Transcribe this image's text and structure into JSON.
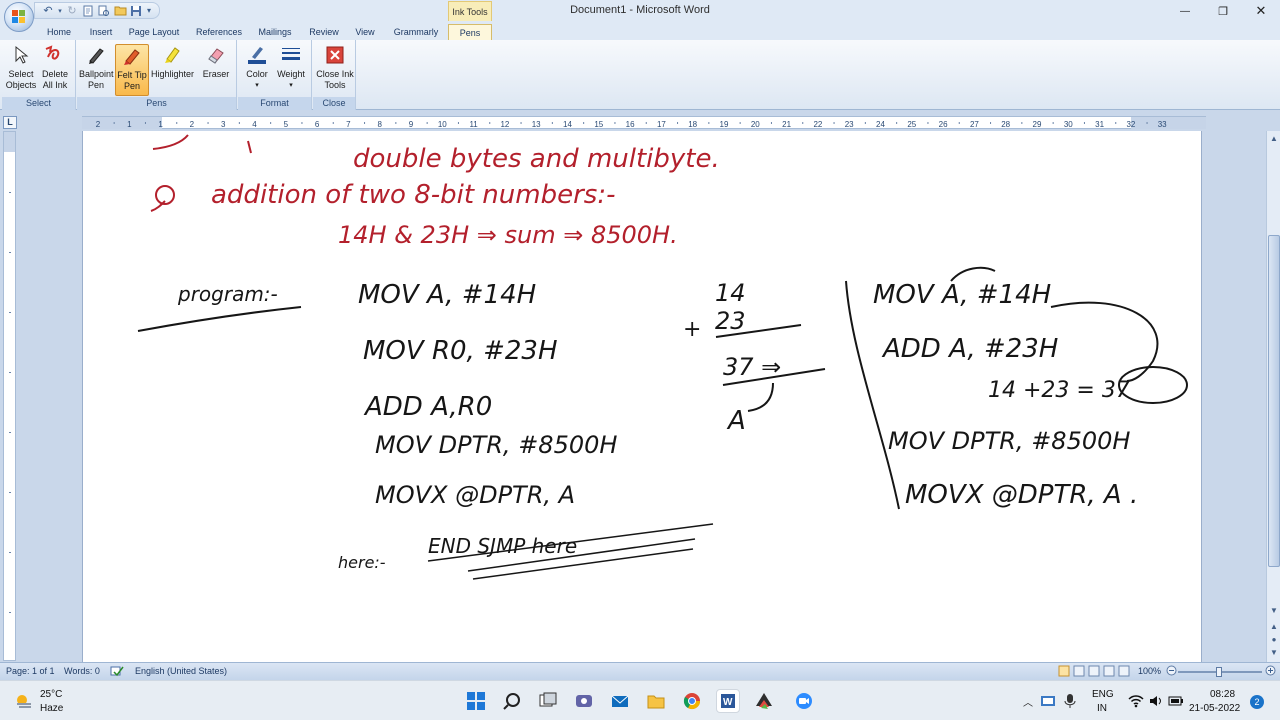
{
  "window": {
    "title": "Document1 - Microsoft Word",
    "context_tab_group": "Ink Tools",
    "controls": {
      "minimize": "—",
      "restore": "❐",
      "close": "✕"
    }
  },
  "tabs": [
    "Home",
    "Insert",
    "Page Layout",
    "References",
    "Mailings",
    "Review",
    "View",
    "Grammarly",
    "Pens"
  ],
  "ribbon": {
    "groups": [
      {
        "label": "Select",
        "buttons": [
          {
            "line1": "Select",
            "line2": "Objects"
          },
          {
            "line1": "Delete",
            "line2": "All Ink"
          }
        ]
      },
      {
        "label": "Pens",
        "buttons": [
          {
            "line1": "Ballpoint",
            "line2": "Pen"
          },
          {
            "line1": "Felt Tip",
            "line2": "Pen"
          },
          {
            "line1": "Highlighter",
            "line2": ""
          },
          {
            "line1": "Eraser",
            "line2": ""
          }
        ]
      },
      {
        "label": "Format",
        "buttons": [
          {
            "line1": "Color",
            "line2": ""
          },
          {
            "line1": "Weight",
            "line2": ""
          }
        ]
      },
      {
        "label": "Close",
        "buttons": [
          {
            "line1": "Close Ink",
            "line2": "Tools"
          }
        ]
      }
    ]
  },
  "ruler": {
    "corner": "L",
    "ticks": [
      "2",
      "1",
      "1",
      "2",
      "3",
      "4",
      "5",
      "6",
      "7",
      "8",
      "9",
      "10",
      "11",
      "12",
      "13",
      "14",
      "15",
      "16",
      "17",
      "18",
      "19",
      "20",
      "21",
      "22",
      "23",
      "24",
      "25",
      "26",
      "27",
      "28",
      "29",
      "30",
      "31",
      "32",
      "33"
    ]
  },
  "ink": {
    "red_lines": [
      "double bytes and multibyte.",
      "addition of two 8-bit numbers:-",
      "14H & 23H ⇒ sum ⇒ 8500H."
    ],
    "label": "program:-",
    "program": [
      "MOV A, #14H",
      "MOV R0, #23H",
      "ADD A,R0",
      "MOV DPTR, #8500H",
      "MOVX @DPTR, A"
    ],
    "here": "here:-",
    "end": "END SJMP here",
    "sum": {
      "a": "14",
      "b": "23",
      "plus": "+",
      "result": "37 ⇒",
      "reg": "A"
    },
    "right_program": [
      "MOV A, #14H",
      "ADD A, #23H",
      "14 +23 = 37",
      "MOV DPTR, #8500H",
      "MOVX @DPTR, A ."
    ]
  },
  "status": {
    "page": "Page: 1 of 1",
    "words": "Words: 0",
    "language": "English (United States)",
    "zoom": "100%"
  },
  "taskbar": {
    "weather_temp": "25°C",
    "weather_desc": "Haze",
    "lang_line1": "ENG",
    "lang_line2": "IN",
    "time": "08:28",
    "date": "21-05-2022",
    "notification_count": "2"
  }
}
